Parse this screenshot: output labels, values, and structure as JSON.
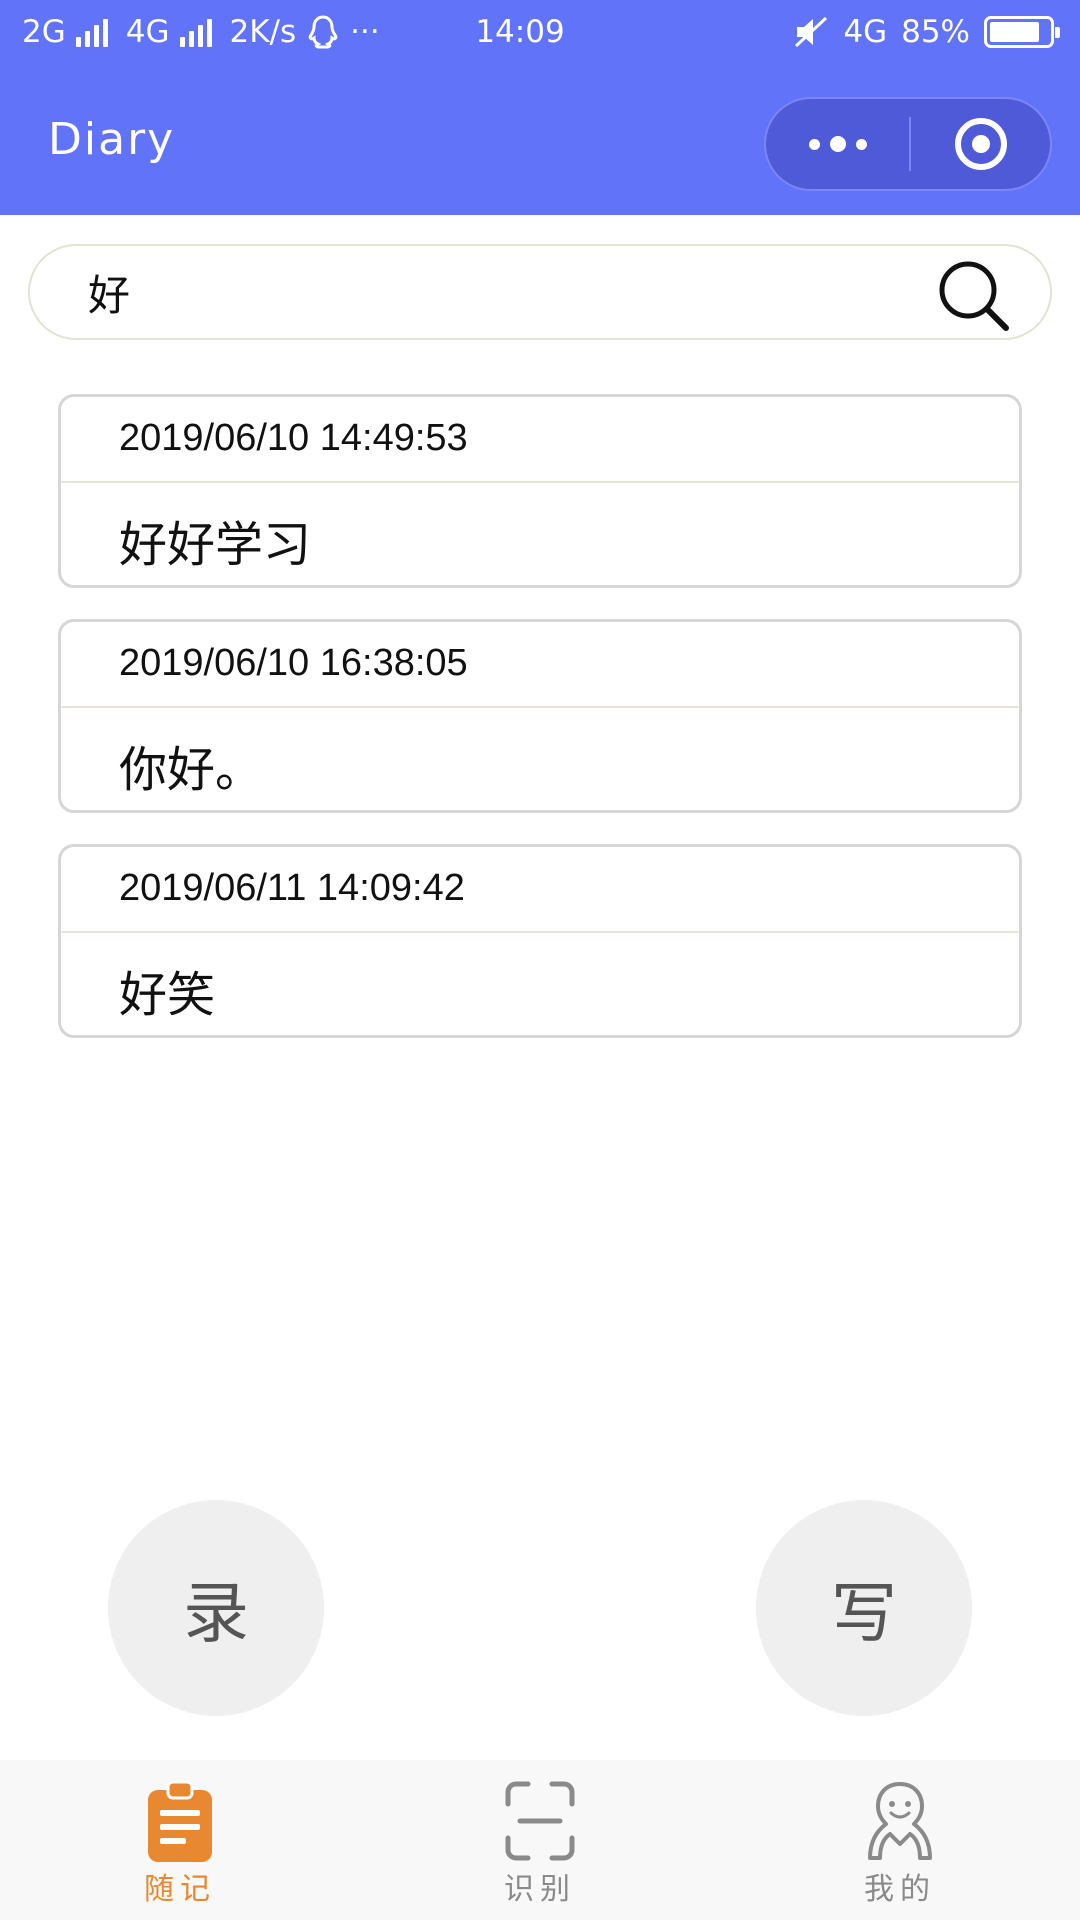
{
  "status_bar": {
    "network1": "2G",
    "network2": "4G",
    "speed": "2K/s",
    "more": "···",
    "time": "14:09",
    "network3": "4G",
    "battery_percent": "85%",
    "battery_level": 0.85
  },
  "nav": {
    "title": "Diary"
  },
  "search": {
    "value": "好"
  },
  "entries": [
    {
      "time": "2019/06/10 14:49:53",
      "content": "好好学习"
    },
    {
      "time": "2019/06/10 16:38:05",
      "content": "你好。"
    },
    {
      "time": "2019/06/11 14:09:42",
      "content": "好笑"
    }
  ],
  "actions": {
    "record_label": "录",
    "write_label": "写"
  },
  "tabs": [
    {
      "label": "随记",
      "icon": "clipboard-icon",
      "active": true
    },
    {
      "label": "识别",
      "icon": "scan-icon",
      "active": false
    },
    {
      "label": "我的",
      "icon": "person-icon",
      "active": false
    }
  ],
  "colors": {
    "header": "#6173f9",
    "accent": "#e88831",
    "tab_inactive": "#8a8a8a"
  }
}
